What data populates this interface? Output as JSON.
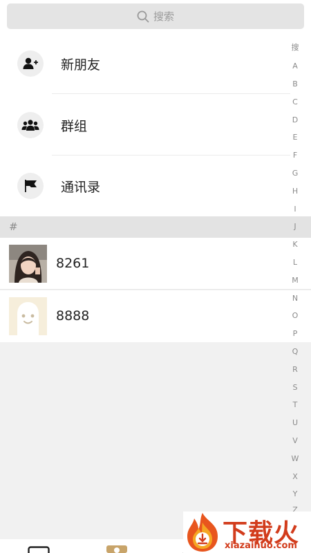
{
  "search": {
    "placeholder": "搜索"
  },
  "menu": [
    {
      "label": "新朋友",
      "icon": "add-user-icon"
    },
    {
      "label": "群组",
      "icon": "group-icon"
    },
    {
      "label": "通讯录",
      "icon": "flag-icon"
    }
  ],
  "section": {
    "label": "#"
  },
  "contacts": [
    {
      "name": "8261",
      "avatar": "photo-avatar"
    },
    {
      "name": "8888",
      "avatar": "default-ghost-avatar"
    }
  ],
  "index_bar": [
    "搜",
    "A",
    "B",
    "C",
    "D",
    "E",
    "F",
    "G",
    "H",
    "I",
    "J",
    "K",
    "L",
    "M",
    "N",
    "O",
    "P",
    "Q",
    "R",
    "S",
    "T",
    "U",
    "V",
    "W",
    "X",
    "Y",
    "Z"
  ],
  "watermark": {
    "title": "下载火",
    "subtitle": "xiazaihuo.com"
  },
  "colors": {
    "background": "#f1f1f1",
    "section": "#e3e3e3",
    "watermark": "#d23c1c"
  }
}
